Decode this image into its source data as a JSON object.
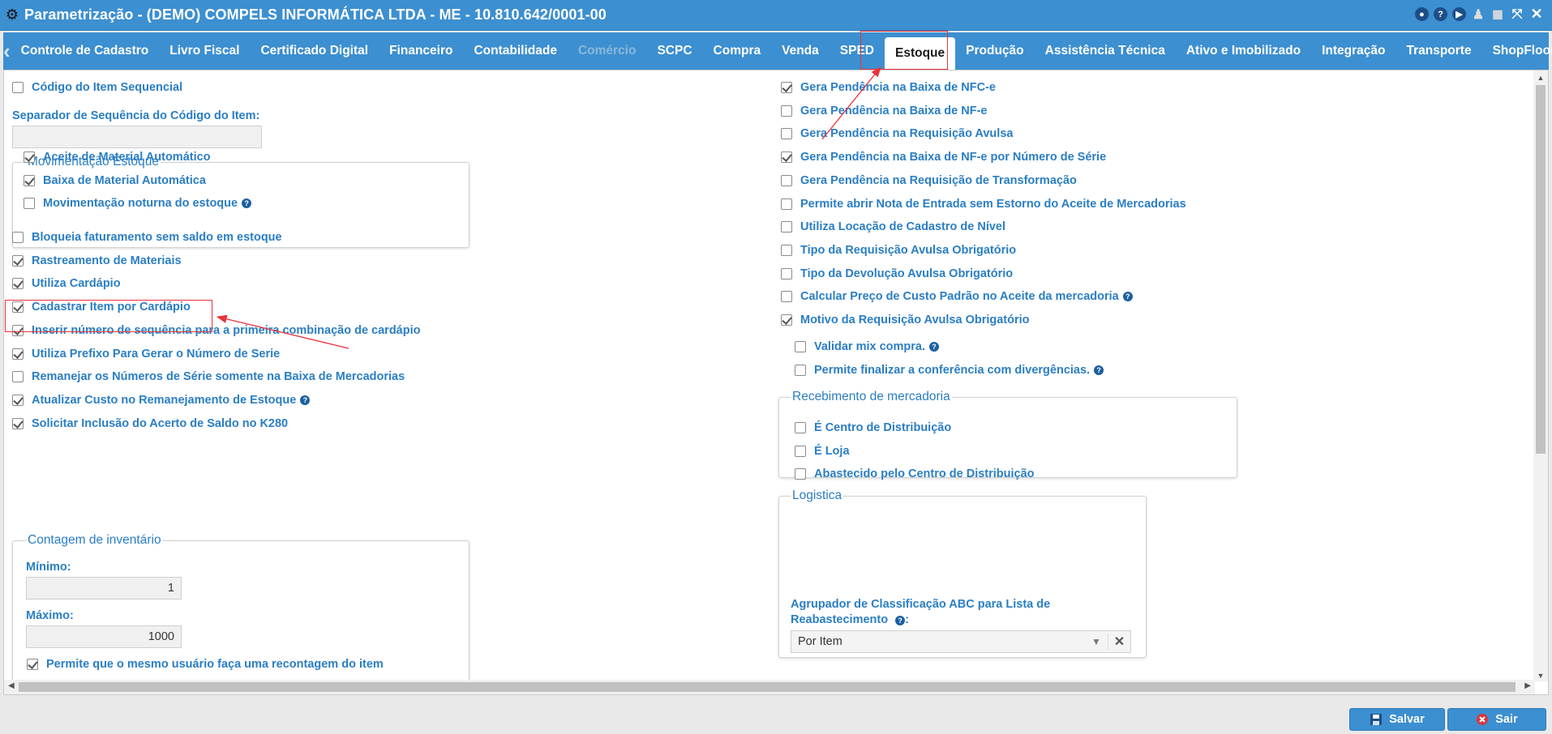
{
  "window": {
    "title": "Parametrização - (DEMO) COMPELS INFORMÁTICA LTDA - ME - 10.810.642/0001-00",
    "controls": [
      "record-icon",
      "help-icon",
      "play-icon",
      "user-icon",
      "calendar-icon",
      "expand-icon",
      "close-icon"
    ]
  },
  "tabs": [
    {
      "label": "Controle de Cadastro",
      "state": "normal"
    },
    {
      "label": "Livro Fiscal",
      "state": "normal"
    },
    {
      "label": "Certificado Digital",
      "state": "normal"
    },
    {
      "label": "Financeiro",
      "state": "normal"
    },
    {
      "label": "Contabilidade",
      "state": "normal"
    },
    {
      "label": "Comércio",
      "state": "disabled"
    },
    {
      "label": "SCPC",
      "state": "normal"
    },
    {
      "label": "Compra",
      "state": "normal"
    },
    {
      "label": "Venda",
      "state": "normal"
    },
    {
      "label": "SPED",
      "state": "normal"
    },
    {
      "label": "Estoque",
      "state": "active"
    },
    {
      "label": "Produção",
      "state": "normal"
    },
    {
      "label": "Assistência Técnica",
      "state": "normal"
    },
    {
      "label": "Ativo e Imobilizado",
      "state": "normal"
    },
    {
      "label": "Integração",
      "state": "normal"
    },
    {
      "label": "Transporte",
      "state": "normal"
    },
    {
      "label": "ShopFloor",
      "state": "normal"
    }
  ],
  "left": {
    "codigo_seq": {
      "label": "Código do Item Sequencial",
      "checked": false
    },
    "separador": {
      "label": "Separador de Sequência do Código do Item:",
      "value": ""
    },
    "mov_estoque": {
      "legend": "Movimentação Estoque",
      "items": [
        {
          "label": "Aceite de Material Automático",
          "checked": true
        },
        {
          "label": "Baixa de Material Automática",
          "checked": true
        },
        {
          "label": "Movimentação noturna do estoque",
          "checked": false
        }
      ]
    },
    "options": [
      {
        "label": "Bloqueia faturamento sem saldo em estoque",
        "checked": false
      },
      {
        "label": "Rastreamento de Materiais",
        "checked": true
      },
      {
        "label": "Utiliza Cardápio",
        "checked": true
      },
      {
        "label": "Cadastrar Item por Cardápio",
        "checked": true
      },
      {
        "label": "Inserir número de sequência para a primeira combinação de cardápio",
        "checked": true
      },
      {
        "label": "Utiliza Prefixo Para Gerar o Número de Serie",
        "checked": true
      },
      {
        "label": "Remanejar os Números de Série somente na Baixa de Mercadorias",
        "checked": false
      },
      {
        "label": "Atualizar Custo no Remanejamento de Estoque",
        "checked": true
      },
      {
        "label": "Solicitar Inclusão do Acerto de Saldo no K280",
        "checked": true
      }
    ],
    "contagem": {
      "legend": "Contagem de inventário",
      "min_label": "Mínimo:",
      "min_value": "1",
      "max_label": "Máximo:",
      "max_value": "1000",
      "recontagem": {
        "label": "Permite que o mesmo usuário faça uma recontagem do item",
        "checked": true
      }
    }
  },
  "right": {
    "options": [
      {
        "label": "Gera Pendência na Baixa de NFC-e",
        "checked": true
      },
      {
        "label": "Gera Pendência na Baixa de NF-e",
        "checked": false
      },
      {
        "label": "Gera Pendência na Requisição Avulsa",
        "checked": false
      },
      {
        "label": "Gera Pendência na Baixa de NF-e por Número de Série",
        "checked": true
      },
      {
        "label": "Gera Pendência na Requisição de Transformação",
        "checked": false
      },
      {
        "label": "Permite abrir Nota de Entrada sem Estorno do Aceite de Mercadorias",
        "checked": false
      },
      {
        "label": "Utiliza Locação de Cadastro de Nível",
        "checked": false
      },
      {
        "label": "Tipo da Requisição Avulsa Obrigatório",
        "checked": false
      },
      {
        "label": "Tipo da Devolução Avulsa Obrigatório",
        "checked": false
      },
      {
        "label": "Calcular Preço de Custo Padrão no Aceite da mercadoria",
        "checked": false
      },
      {
        "label": "Motivo da Requisição Avulsa Obrigatório",
        "checked": true
      }
    ],
    "recebimento": {
      "legend": "Recebimento de mercadoria",
      "items": [
        {
          "label": "Validar mix compra.",
          "checked": false
        },
        {
          "label": "Permite finalizar a conferência com divergências.",
          "checked": false
        }
      ]
    },
    "logistica": {
      "legend": "Logistica",
      "items": [
        {
          "label": "É Centro de Distribuição",
          "checked": false
        },
        {
          "label": "É Loja",
          "checked": false
        },
        {
          "label": "Abastecido pelo Centro de Distribuição",
          "checked": false
        }
      ],
      "agrupador_label_1": "Agrupador de Classificação ABC para Lista de",
      "agrupador_label_2": "Reabastecimento",
      "agrupador_value": "Por Item"
    }
  },
  "footer": {
    "save_label": "Salvar",
    "exit_label": "Sair"
  },
  "colors": {
    "accent": "#3c8fd0",
    "label": "#2a7ec4",
    "annotation": "#e8323c"
  }
}
